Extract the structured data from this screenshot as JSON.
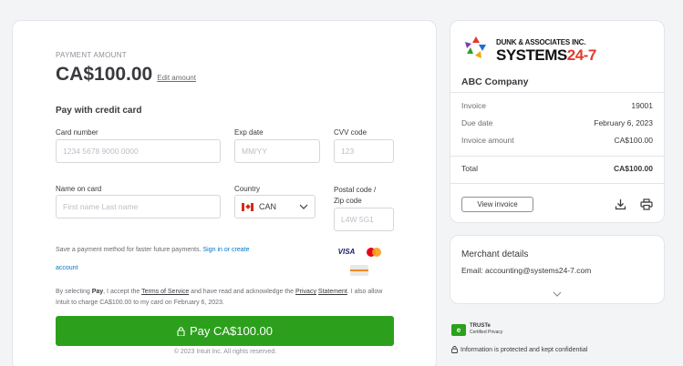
{
  "payment": {
    "amount_label": "PAYMENT AMOUNT",
    "amount": "CA$100.00",
    "edit_label": "Edit amount",
    "section_title": "Pay with credit card",
    "card_number": {
      "label": "Card number",
      "placeholder": "1234 5678 9000 0000"
    },
    "exp_date": {
      "label": "Exp date",
      "placeholder": "MM/YY"
    },
    "cvv": {
      "label": "CVV code",
      "placeholder": "123"
    },
    "name_on_card": {
      "label": "Name on card",
      "placeholder": "First name Last name"
    },
    "country": {
      "label": "Country",
      "value": "CAN"
    },
    "postal": {
      "label_line1": "Postal code /",
      "label_line2": "Zip code",
      "placeholder": "L4W 5G1"
    },
    "save_text": "Save a payment method for faster future payments.",
    "signin_link": "Sign in or create",
    "signin_link2": "account",
    "consent_part1": "By selecting",
    "consent_bold": "Pay",
    "consent_part2": ", I accept the",
    "terms_link": "Terms of Service",
    "consent_part3": "and have read and acknowledge the",
    "privacy_link": "Privacy",
    "privacy_link2": "Statement",
    "consent_part4": ". I also allow Intuit to charge CA$100.00 to my card on February 6, 2023.",
    "pay_button": "Pay CA$100.00",
    "copyright": "© 2023 Intuit Inc. All rights reserved."
  },
  "invoice": {
    "logo_top": "DUNK & ASSOCIATES INC.",
    "logo_main": "SYSTEMS",
    "logo_accent": "24-7",
    "company": "ABC Company",
    "rows": [
      {
        "key": "Invoice",
        "value": "19001"
      },
      {
        "key": "Due date",
        "value": "February 6, 2023"
      },
      {
        "key": "Invoice amount",
        "value": "CA$100.00"
      }
    ],
    "total_key": "Total",
    "total_value": "CA$100.00",
    "view_button": "View invoice"
  },
  "merchant": {
    "title": "Merchant details",
    "email": "Email: accounting@systems24-7.com"
  },
  "footer": {
    "trust_line1": "TRUSTe",
    "trust_line2": "Certified Privacy",
    "secure_note": "Information is protected and kept confidential"
  },
  "icons": {
    "download": "download-icon",
    "print": "printer-icon",
    "lock": "lock-icon",
    "chevron": "chevron-down-icon"
  },
  "colors": {
    "primary_green": "#2ca01c",
    "link_blue": "#0077c5",
    "visa_blue": "#1a1f71",
    "mastercard_red": "#eb001b",
    "mastercard_orange": "#f79e1b"
  }
}
